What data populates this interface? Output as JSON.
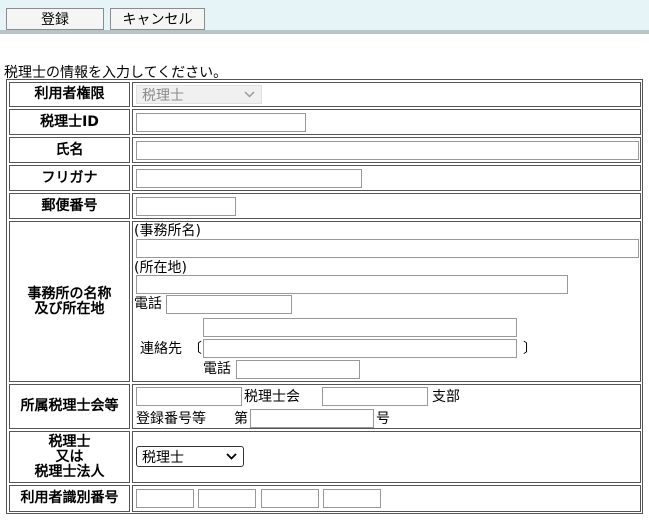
{
  "toolbar": {
    "register_label": "登録",
    "cancel_label": "キャンセル"
  },
  "intro_text": "税理士の情報を入力してください。",
  "rows": {
    "user_role": {
      "label": "利用者権限",
      "selected": "税理士"
    },
    "tax_accountant_id": {
      "label": "税理士ID"
    },
    "name": {
      "label": "氏名"
    },
    "furigana": {
      "label": "フリガナ"
    },
    "postal_code": {
      "label": "郵便番号"
    },
    "office": {
      "label_line1": "事務所の名称",
      "label_line2": "及び所在地",
      "office_name_caption": "(事務所名)",
      "address_caption": "(所在地)",
      "phone_label": "電話",
      "contact_label": "連絡先",
      "bracket_open": "〔",
      "bracket_close": "〕",
      "contact_phone_label": "電話"
    },
    "association": {
      "label": "所属税理士会等",
      "association_suffix": "税理士会",
      "branch_suffix": "支部",
      "registration_label": "登録番号等",
      "number_prefix": "第",
      "number_suffix": "号"
    },
    "tax_type": {
      "label_line1": "税理士",
      "label_line2": "又は",
      "label_line3": "税理士法人",
      "selected": "税理士"
    },
    "user_identifier": {
      "label": "利用者識別番号"
    }
  },
  "colors": {
    "toolbar_bg": "#e6f4f8",
    "toolbar_border": "#b8c4c8",
    "grid": "#555555",
    "disabled_text": "#8c8c8c"
  }
}
